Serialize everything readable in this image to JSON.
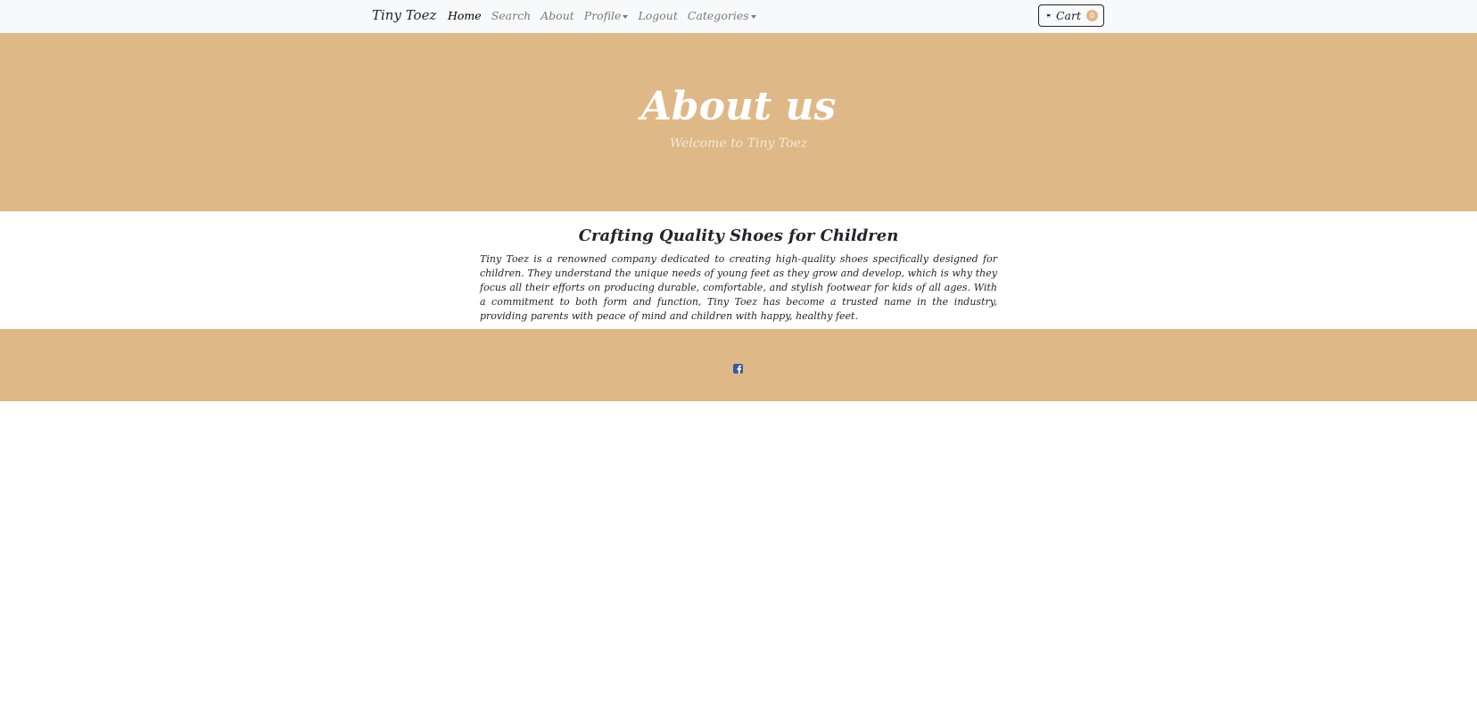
{
  "navbar": {
    "brand": "Tiny Toez",
    "links": [
      {
        "label": "Home"
      },
      {
        "label": "Search"
      },
      {
        "label": "About"
      },
      {
        "label": "Profile"
      },
      {
        "label": "Logout"
      },
      {
        "label": "Categories"
      }
    ],
    "cart": {
      "label": "Cart",
      "count": "0",
      "icon": "cart-icon"
    }
  },
  "hero": {
    "title": "About us",
    "subtitle": "Welcome to Tiny Toez"
  },
  "about": {
    "heading": "Crafting Quality Shoes for Children",
    "text": "Tiny Toez is a renowned company dedicated to creating high-quality shoes specifically designed for children. They understand the unique needs of young feet as they grow and develop, which is why they focus all their efforts on producing durable, comfortable, and stylish footwear for kids of all ages. With a commitment to both form and function, Tiny Toez has become a trusted name in the industry, providing parents with peace of mind and children with happy, healthy feet."
  },
  "footer": {
    "social_icon": "facebook-icon"
  },
  "colors": {
    "accent": "#deb887",
    "navbar_bg": "#f8f9fa",
    "social": "#3b5998"
  }
}
